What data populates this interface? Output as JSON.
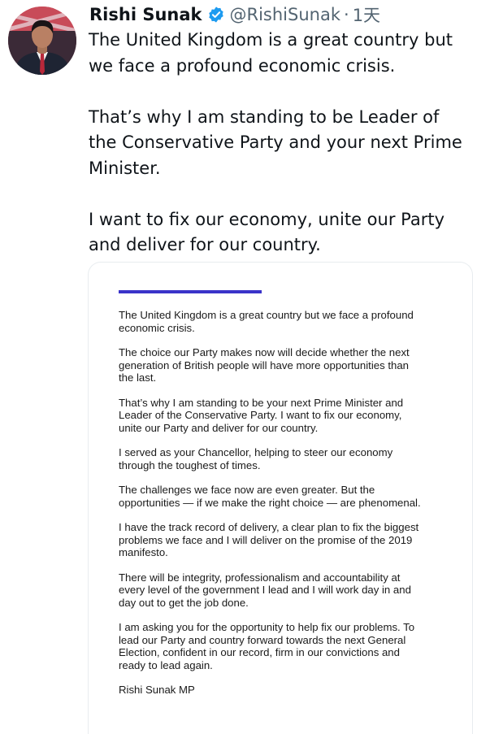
{
  "author": {
    "name": "Rishi Sunak",
    "handle": "@RishiSunak",
    "separator": "·",
    "time": "1天",
    "verified_color": "#1d9bf0"
  },
  "tweet": {
    "paragraphs": [
      "The United Kingdom is a great country but we face a profound economic crisis.",
      "That’s why I am standing to be Leader of the Conservative Party and your next Prime Minister.",
      "I want to fix our economy, unite our Party and deliver for our country."
    ]
  },
  "letter": {
    "accent_color": "#3a33c9",
    "paragraphs": [
      "The United Kingdom is a great country but we face a profound economic crisis.",
      "The choice our Party makes now will decide whether the next generation of British people will have more opportunities than the last.",
      "That’s why I am standing to be your next Prime Minister and Leader of the Conservative Party. I want to fix our economy, unite our Party and deliver for our country.",
      "I served as your Chancellor, helping to steer our economy through the toughest of times.",
      "The challenges we face now are even greater. But the opportunities — if we make the right choice — are phenomenal.",
      "I have the track record of delivery, a clear plan to fix the biggest problems we face and I will deliver on the promise of the 2019 manifesto.",
      "There will be integrity, professionalism and accountability at every level of the government I lead and I will work day in and day out to get the job done.",
      "I am asking you for the opportunity to help fix our problems. To lead our Party and country forward towards the next General Election, confident in our record, firm in our convictions and ready to lead again."
    ],
    "signature": "Rishi Sunak MP"
  }
}
